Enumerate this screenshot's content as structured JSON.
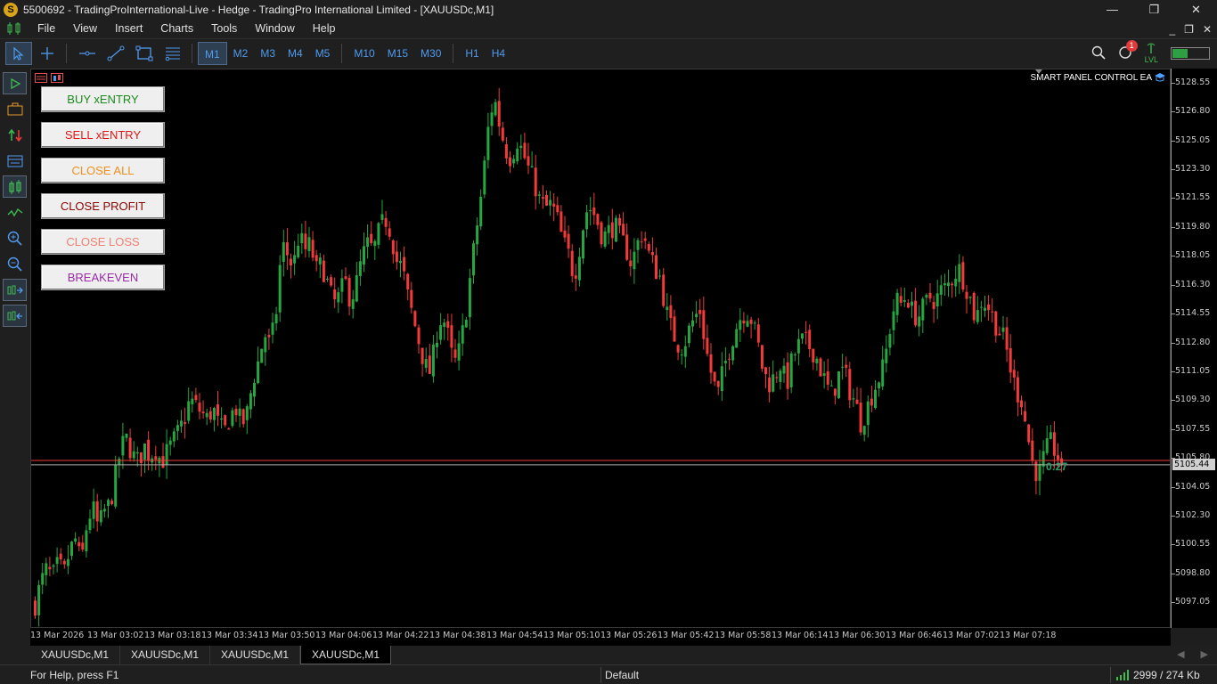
{
  "window": {
    "title": "5500692 - TradingProInternational-Live - Hedge - TradingPro International Limited - [XAUUSDc,M1]",
    "app_icon": "S",
    "controls": [
      "—",
      "❐",
      "✕"
    ]
  },
  "menu": {
    "items": [
      "File",
      "View",
      "Insert",
      "Charts",
      "Tools",
      "Window",
      "Help"
    ],
    "mdi_controls": [
      "_",
      "❐",
      "✕"
    ]
  },
  "toolbar": {
    "tools": [
      "cursor-icon",
      "crosshair-icon",
      "horizontal-line-icon",
      "trendline-icon",
      "rectangle-icon",
      "fibonacci-icon"
    ],
    "timeframes": [
      "M1",
      "M2",
      "M3",
      "M4",
      "M5",
      "M10",
      "M15",
      "M30",
      "H1",
      "H4"
    ],
    "active_timeframe": "M1",
    "notification_count": "1",
    "lvl_label": "LVL"
  },
  "left_toolbar": {
    "tools": [
      "play-icon",
      "portfolio-icon",
      "trade-arrows-icon",
      "terminal-icon",
      "candles-icon",
      "indicator-wave-icon",
      "zoom-in-icon",
      "zoom-out-icon",
      "scroll-right-icon",
      "scroll-left-icon"
    ]
  },
  "panel": {
    "buttons": [
      {
        "label": "BUY xENTRY",
        "color": "#1a8a1a"
      },
      {
        "label": "SELL xENTRY",
        "color": "#e01818"
      },
      {
        "label": "CLOSE ALL",
        "color": "#f0901e"
      },
      {
        "label": "CLOSE PROFIT",
        "color": "#8b0000"
      },
      {
        "label": "CLOSE LOSS",
        "color": "#f08070"
      },
      {
        "label": "BREAKEVEN",
        "color": "#9a2aa8"
      }
    ],
    "ea_label": "SMART PANEL CONTROL EA"
  },
  "chart_data": {
    "type": "candlestick",
    "symbol": "XAUUSDc",
    "timeframe": "M1",
    "bull_color": "#26a641",
    "bear_color": "#f23a3a",
    "background": "#000000",
    "ylim": [
      5095.5,
      5129.4
    ],
    "y_ticks": [
      "5128.55",
      "5126.80",
      "5125.05",
      "5123.30",
      "5121.55",
      "5119.80",
      "5118.05",
      "5116.30",
      "5114.55",
      "5112.80",
      "5111.05",
      "5109.30",
      "5107.55",
      "5105.80",
      "5104.05",
      "5102.30",
      "5100.55",
      "5098.80",
      "5097.05"
    ],
    "current_price": "5105.44",
    "bid_line": 5105.44,
    "ask_line": 5105.7,
    "countdown": "0:27",
    "x_labels": [
      "13 Mar 2026",
      "13 Mar 03:02",
      "13 Mar 03:18",
      "13 Mar 03:34",
      "13 Mar 03:50",
      "13 Mar 04:06",
      "13 Mar 04:22",
      "13 Mar 04:38",
      "13 Mar 04:54",
      "13 Mar 05:10",
      "13 Mar 05:26",
      "13 Mar 05:42",
      "13 Mar 05:58",
      "13 Mar 06:14",
      "13 Mar 06:30",
      "13 Mar 06:46",
      "13 Mar 07:02",
      "13 Mar 07:18"
    ],
    "close_path": [
      5097.0,
      5098.3,
      5099.1,
      5098.6,
      5099.4,
      5098.8,
      5100.2,
      5100.9,
      5099.4,
      5101.8,
      5102.9,
      5101.6,
      5102.6,
      5103.0,
      5104.7,
      5106.5,
      5107.0,
      5106.0,
      5105.6,
      5106.6,
      5106.0,
      5106.4,
      5105.6,
      5106.2,
      5106.8,
      5107.4,
      5108.2,
      5109.4,
      5109.0,
      5108.6,
      5108.2,
      5108.9,
      5107.8,
      5107.4,
      5108.4,
      5108.9,
      5107.8,
      5108.6,
      5110.6,
      5111.8,
      5113.4,
      5112.6,
      5114.6,
      5118.8,
      5118.2,
      5117.4,
      5119.4,
      5118.4,
      5118.8,
      5117.2,
      5117.6,
      5116.4,
      5115.2,
      5115.6,
      5116.6,
      5115.4,
      5116.4,
      5118.0,
      5118.8,
      5118.4,
      5119.6,
      5120.4,
      5119.6,
      5117.8,
      5117.4,
      5115.6,
      5114.2,
      5112.8,
      5111.4,
      5111.0,
      5113.4,
      5114.6,
      5113.2,
      5111.4,
      5112.4,
      5114.4,
      5117.2,
      5119.8,
      5122.4,
      5125.8,
      5127.8,
      5126.0,
      5124.6,
      5124.0,
      5125.2,
      5124.4,
      5123.4,
      5122.6,
      5121.4,
      5121.0,
      5121.2,
      5120.4,
      5119.0,
      5118.2,
      5116.8,
      5118.8,
      5120.8,
      5121.0,
      5120.2,
      5119.2,
      5119.6,
      5120.0,
      5119.2,
      5118.6,
      5117.6,
      5118.8,
      5119.6,
      5118.2,
      5117.4,
      5116.8,
      5114.8,
      5113.6,
      5112.8,
      5112.6,
      5113.6,
      5114.4,
      5114.8,
      5112.4,
      5110.8,
      5109.6,
      5111.2,
      5112.4,
      5113.6,
      5114.4,
      5114.8,
      5114.2,
      5112.8,
      5111.0,
      5110.4,
      5110.8,
      5111.6,
      5110.2,
      5111.8,
      5112.6,
      5113.0,
      5112.6,
      5112.2,
      5111.2,
      5110.2,
      5109.6,
      5110.8,
      5111.2,
      5110.0,
      5109.2,
      5108.0,
      5108.8,
      5109.8,
      5110.6,
      5111.4,
      5113.6,
      5115.4,
      5115.2,
      5115.8,
      5114.6,
      5114.4,
      5115.0,
      5115.6,
      5115.4,
      5116.0,
      5116.2,
      5116.8,
      5117.4,
      5116.6,
      5115.6,
      5114.2,
      5115.4,
      5115.2,
      5114.4,
      5113.6,
      5113.0,
      5111.4,
      5110.0,
      5109.4,
      5107.4,
      5105.4,
      5104.8,
      5106.0,
      5106.8,
      5106.2,
      5105.44
    ]
  },
  "tabs": {
    "items": [
      "XAUUSDc,M1",
      "XAUUSDc,M1",
      "XAUUSDc,M1",
      "XAUUSDc,M1"
    ],
    "active_index": 3
  },
  "status": {
    "help": "For Help, press F1",
    "profile": "Default",
    "traffic": "2999 / 274 Kb"
  }
}
